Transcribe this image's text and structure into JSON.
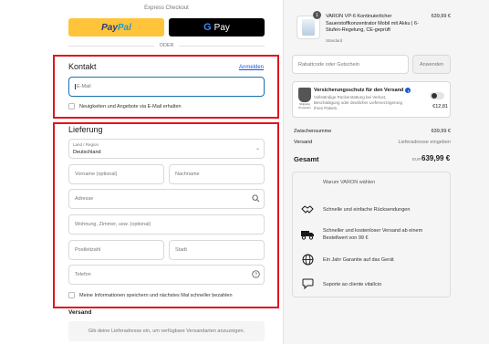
{
  "express": {
    "title": "Express Checkout",
    "paypal_label_a": "Pay",
    "paypal_label_b": "Pal",
    "gpay_g": "G",
    "gpay_label": "Pay",
    "or_label": "ODER"
  },
  "contact": {
    "title": "Kontakt",
    "login_link": "Anmelden",
    "email_placeholder": "E-Mail",
    "newsletter_label": "Neuigkeiten und Angebote via E-Mail erhalten"
  },
  "delivery": {
    "title": "Lieferung",
    "country_label": "Land / Region",
    "country_value": "Deutschland",
    "first_name_placeholder": "Vorname (optional)",
    "last_name_placeholder": "Nachname",
    "address_placeholder": "Adresse",
    "address2_placeholder": "Wohnung, Zimmer, usw. (optional)",
    "zip_placeholder": "Postleitzahl",
    "city_placeholder": "Stadt",
    "phone_placeholder": "Telefon",
    "save_info_label": "Meine Informationen speichern und nächstes Mal schneller bezahlen"
  },
  "shipping": {
    "title": "Versand",
    "info": "Gib deine Lieferadresse ein, um verfügbare Versandarten anzuzeigen."
  },
  "cart": {
    "quantity": "1",
    "product_name": "VARON VP-6 Kontinuierlicher Sauerstoffkonzentrator Mobil mit Akku | 6-Stufen-Regelung, CE-geprüft",
    "variant": "Standard",
    "price": "639,99 €"
  },
  "coupon": {
    "placeholder": "Rabattcode oder Gutschein",
    "apply_label": "Anwenden"
  },
  "insurance": {
    "title": "Versicherungsschutz für den Versand",
    "description": "Vollständige Rückerstattung bei Verlust, Beschädigung oder deutlicher Lieferverzögerung Ihres Pakets.",
    "icon_label": "Shipping Protection",
    "price": "€12,81",
    "enabled": false
  },
  "summary": {
    "subtotal_label": "Zwischensumme",
    "subtotal_value": "639,99 €",
    "shipping_label": "Versand",
    "shipping_value": "Lieferadresse eingeben",
    "total_label": "Gesamt",
    "total_currency": "EUR",
    "total_value": "639,99 €"
  },
  "why": {
    "title": "Warum VARON wählen",
    "features": [
      {
        "icon": "handshake-icon",
        "text": "Schnelle und einfache Rücksendungen"
      },
      {
        "icon": "truck-icon",
        "text": "Schneller und kostenloser Versand ab einem Bestellwert von 99 €"
      },
      {
        "icon": "globe-icon",
        "text": "Ein Jahr Garantie auf das Gerät"
      },
      {
        "icon": "chat-icon",
        "text": "Suporte ao cliente vitalício"
      }
    ]
  },
  "colors": {
    "highlight_border": "#e0141e",
    "paypal_yellow": "#ffc439",
    "link_blue": "#1a56db",
    "focus_blue": "#1773b0"
  }
}
